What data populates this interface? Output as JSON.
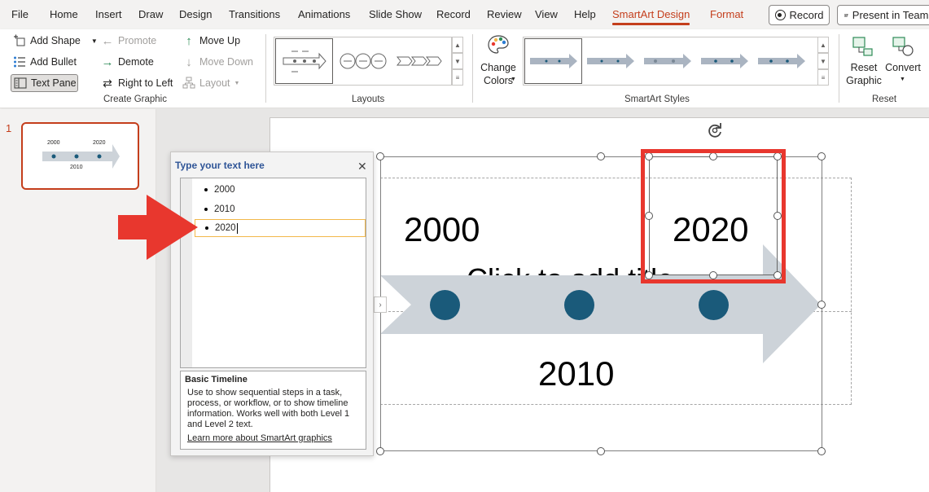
{
  "menu": {
    "tabs": [
      "File",
      "Home",
      "Insert",
      "Draw",
      "Design",
      "Transitions",
      "Animations",
      "Slide Show",
      "Record",
      "Review",
      "View",
      "Help",
      "SmartArt Design",
      "Format"
    ],
    "active_tab": "SmartArt Design",
    "record_label": "Record",
    "present_label": "Present in Teams"
  },
  "ribbon": {
    "create_graphic": {
      "add_shape": "Add Shape",
      "add_bullet": "Add Bullet",
      "text_pane": "Text Pane",
      "promote": "Promote",
      "demote": "Demote",
      "right_to_left": "Right to Left",
      "move_up": "Move Up",
      "move_down": "Move Down",
      "layout": "Layout",
      "group_label": "Create Graphic"
    },
    "layouts": {
      "group_label": "Layouts"
    },
    "styles": {
      "change_colors": "Change Colors",
      "change_colors_line1": "Change",
      "change_colors_line2": "Colors",
      "group_label": "SmartArt Styles"
    },
    "reset": {
      "reset_line1": "Reset",
      "reset_line2": "Graphic",
      "convert": "Convert",
      "group_label": "Reset"
    }
  },
  "slides": {
    "number": "1",
    "thumb_labels": [
      "2000",
      "2020",
      "2010"
    ]
  },
  "text_pane": {
    "title": "Type your text here",
    "items": [
      "2000",
      "2010",
      "2020"
    ],
    "description_title": "Basic Timeline",
    "description": "Use to show sequential steps in a task, process, or workflow, or to show timeline information. Works well with both Level 1 and Level 2 text.",
    "learn_more": "Learn more about SmartArt graphics"
  },
  "smartart": {
    "title_placeholder": "Click to add title",
    "label_top_left": "2000",
    "label_top_right": "2020",
    "label_bottom": "2010",
    "arrow_color": "#cdd3d9",
    "node_color": "#1a5a7a"
  },
  "highlight_color": "#e8372e"
}
